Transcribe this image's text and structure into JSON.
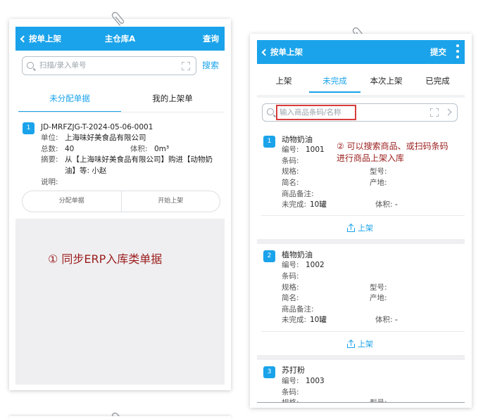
{
  "left_screen": {
    "header": {
      "back_label": "按单上架",
      "title": "主仓库A",
      "action": "查询"
    },
    "search": {
      "placeholder": "扫描/录入单号",
      "button": "搜索"
    },
    "tabs": [
      {
        "label": "未分配单据",
        "active": true
      },
      {
        "label": "我的上架单",
        "active": false
      }
    ],
    "order": {
      "index": "1",
      "code": "JD-MRFZJG-T-2024-05-06-0001",
      "unit_label": "单位:",
      "unit_value": "上海味好美食品有限公司",
      "total_label": "总数:",
      "total_value": "40",
      "volume_label": "体积:",
      "volume_value": "0m³",
      "summary_label": "摘要:",
      "summary_line1": "从【上海味好美食品有限公司】购进【动物奶",
      "summary_line2": "油】等: 小赵",
      "note_label": "说明:",
      "note_value": ""
    },
    "actions": {
      "assign": "分配单据",
      "start": "开始上架"
    },
    "annotation": "① 同步ERP入库类单据"
  },
  "right_screen": {
    "header": {
      "back_label": "按单上架",
      "action": "提交",
      "menu_icon": "more-vertical-icon"
    },
    "tabs": [
      {
        "label": "上架",
        "active": false
      },
      {
        "label": "未完成",
        "active": true
      },
      {
        "label": "本次上架",
        "active": false
      },
      {
        "label": "已完成",
        "active": false
      }
    ],
    "search": {
      "placeholder": "输入商品条码/名称"
    },
    "annotation_line1": "② 可以搜索商品、或扫码条码",
    "annotation_line2": "进行商品上架入库",
    "labels": {
      "code": "编号:",
      "barcode": "条码:",
      "spec": "规格:",
      "model": "型号:",
      "short": "简名:",
      "origin": "产地:",
      "remark": "商品备注:",
      "incomplete": "未完成:",
      "volume": "体积:",
      "shelve_button": "上架"
    },
    "items": [
      {
        "index": "1",
        "name": "动物奶油",
        "code": "1001",
        "incomplete": "10罐",
        "volume": "-"
      },
      {
        "index": "2",
        "name": "植物奶油",
        "code": "1002",
        "incomplete": "10罐",
        "volume": "-"
      },
      {
        "index": "3",
        "name": "苏打粉",
        "code": "1003"
      }
    ]
  },
  "colors": {
    "primary": "#1aa3ea",
    "annotation": "#9b1c1c",
    "highlight_box": "#d83b3b"
  }
}
